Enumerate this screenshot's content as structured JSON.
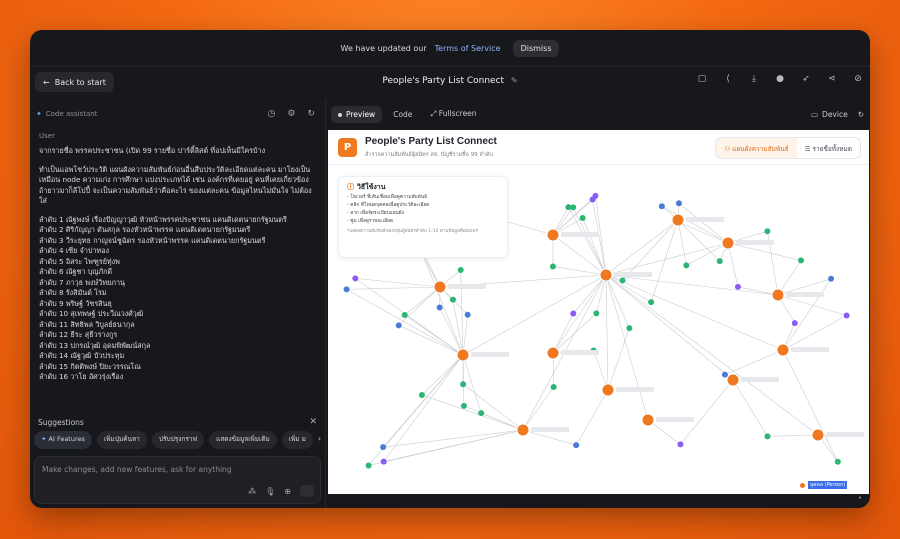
{
  "notice": {
    "text": "We have updated our",
    "link": "Terms of Service",
    "dismiss": "Dismiss"
  },
  "topbar": {
    "back_label": "Back to start",
    "project_title": "People's Party List Connect",
    "icons": [
      "clipboard-icon",
      "share-icon",
      "download-icon",
      "github-icon",
      "rocket-icon",
      "share-alt-icon",
      "eye-off-icon"
    ]
  },
  "left_panel": {
    "header": "Code assistant",
    "role": "User",
    "msg_p1": "จากรายชื่อ พรรคประชาชน (เปิด 99 รายชื่อ ปาร์ตี้ลิสต์ ที่อปเห็นมีใครบ้าง",
    "msg_p2": "ทำเป็นแอพโชว์ประวัติ แผนผังความสัมพันธ์ก่อนอื่นสืบประวัติละเอียดแต่ละคน มาโยงเป็นเหมือน node ความเก่ง การศึกษา แบ่งประเภทได้ เช่น องค์กรที่เคยอยู่ คนที่เคยเกี่ยวข้อง ถ้ายาวมาก็ลีโปปี้ จะเป็นความสัมพันธ์ว่าคือคะไร ของแต่ละคน ข้อมูลไหนไม่มั่นใจ ไม่ต้องใส่",
    "list": [
      "ลำดับ 1 ณัฐพงษ์ เรืองปัญญาวุฒิ หัวหน้าพรรคประชาชน แคนดิเดตนายกรัฐมนตรี",
      "ลำดับ 2 ศิริกัญญา ตันสกุล รองหัวหน้าพรรค แคนดิเดตนายกรัฐมนตรี",
      "ลำดับ 3 วีระยุทธ กาญจน์ชูฉัตร รองหัวหน้าพรรค แคนดิเดตนายกรัฐมนตรี",
      "ลำดับ 4 เซีย จำปาทอง",
      "ลำดับ 5 อิสระ ไพฑูรย์ทุ่งพ",
      "ลำดับ 6 ณัฐชา บุญภักดี",
      "ลำดับ 7 ภาวุธ พงษ์วิทยภานุ",
      "ลำดับ 8 รังสิมันต์ โรม",
      "ลำดับ 9 พริษฐ์ วัชรสินธุ",
      "ลำดับ 10 สุเทพษฐ์ ประวีณวงศ์วุฒิ",
      "ลำดับ 11 สิทธิพล วิบูลย์ธนากุล",
      "ลำดับ 12 ธีระ สุธีวรางกูร",
      "ลำดับ 13 ปกรณ์วุฒิ อุดมพิพัฒน์สกุล",
      "ลำดับ 14 ณัฐวุฒิ บัวประทุม",
      "ลำดับ 15 กิตติพงษ์ ปิยะวรรณโณ",
      "ลำดับ 16 วาโย อัศวรุ่งเรือง"
    ],
    "suggestions_title": "Suggestions",
    "chips": [
      "AI Features",
      "เพิ่มปุ่มค้นหา",
      "ปรับปรุงกราฟ",
      "แสดงข้อมูลเพิ่มเติม",
      "เพิ่ม ม"
    ],
    "prompt_placeholder": "Make changes, add new features, ask for anything"
  },
  "right_panel": {
    "tabs": [
      "Preview",
      "Code",
      "Fullscreen"
    ],
    "device_label": "Device"
  },
  "app": {
    "logo_letter": "P",
    "title": "People's Party List Connect",
    "subtitle": "สำรวจความสัมพันธ์ผู้สมัคร สส. บัญชีรายชื่อ 99 ลำดับ",
    "view_graph": "แผนผังความสัมพันธ์",
    "view_list": "รายชื่อทั้งหมด",
    "howto_title": "วิธีใช้งาน",
    "howto_lines": [
      "- โฮเวอร์ ที่เส้นเชื่อมเพื่อดูความสัมพันธ์",
      "- คลิก ที่โหนดบุคคลเพื่อดูประวัติละเอียด",
      "- ลาก เพื่อจัดระเบียบแผนผัง",
      "- ซูม เพื่อดูรายละเอียด"
    ],
    "howto_note": "*แสดงความสัมพันธ์ของกลุ่มผู้สมัครลำดับ 1-10 ตามข้อมูลที่เผยแพร่",
    "legend_label": "บุคคล (Person)"
  },
  "colors": {
    "person": "#f0781f",
    "org": "#2bb673",
    "topic": "#8a5cf6",
    "edu": "#4a7bd8"
  }
}
